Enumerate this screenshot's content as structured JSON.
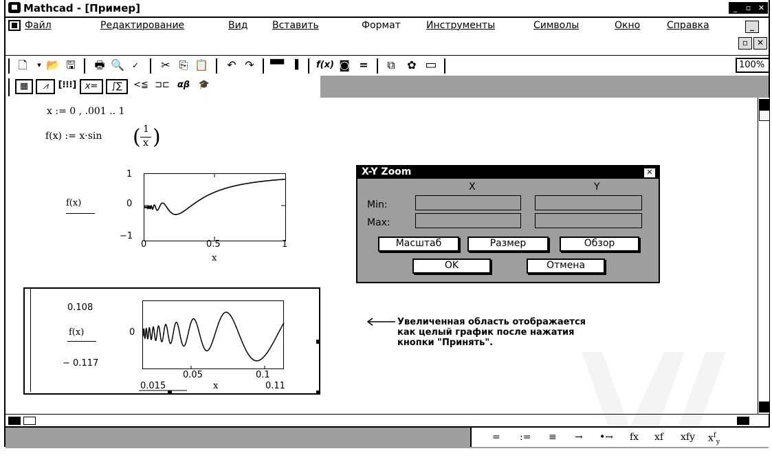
{
  "window": {
    "title": "Mathcad - [Пример]"
  },
  "menu": {
    "items": [
      "Файл",
      "Редактирование",
      "Вид",
      "Вставить",
      "Формат",
      "Инструменты",
      "Символы",
      "Окно",
      "Справка"
    ]
  },
  "toolbar": {
    "zoom": "100%"
  },
  "math_toolbar": {
    "eq_label": "x=",
    "compare_label": "<≦",
    "greek_label": "αβ"
  },
  "worksheet": {
    "range_def": "x := 0 , .001 .. 1",
    "func_def_prefix": "f(x) := x·sin",
    "func_def_num": "1",
    "func_def_den": "x",
    "plot1": {
      "ylabel": "f(x)",
      "xlabel": "x",
      "y_ticks": [
        "1",
        "0",
        "−1"
      ],
      "x_ticks": [
        "0",
        "0.5",
        "1"
      ]
    },
    "plot2": {
      "ylabel": "f(x)",
      "xlabel": "x",
      "y_top": "0.108",
      "y_mid": "0",
      "y_bottom": "− 0.117",
      "x_ticks": [
        "0.05",
        "0.1"
      ],
      "x_min": "0.015",
      "x_max": "0.11"
    },
    "annotation": [
      "Увеличенная область отображается",
      "как целый график после нажатия",
      "кнопки \"Принять\"."
    ]
  },
  "dialog": {
    "title": "X-Y Zoom",
    "col_x": "X",
    "col_y": "Y",
    "min_label": "Min:",
    "max_label": "Max:",
    "buttons": {
      "zoom": "Масштаб",
      "resize": "Размер",
      "browse": "Обзор",
      "ok": "OK",
      "cancel": "Отмена"
    }
  },
  "status": {
    "symbols": [
      "=",
      ":=",
      "≡",
      "→",
      "•→",
      "fx",
      "xf",
      "xfy"
    ]
  },
  "watermark": "УИР",
  "chart_data": [
    {
      "type": "line",
      "ylabel": "f(x)",
      "xlabel": "x",
      "xlim": [
        0,
        1
      ],
      "ylim": [
        -1,
        1
      ],
      "x": [
        0.2,
        0.25,
        0.3,
        0.4,
        0.5,
        0.6,
        0.7,
        0.8,
        0.9,
        1.0
      ],
      "y": [
        -0.19,
        -0.19,
        -0.06,
        0.24,
        0.45,
        0.6,
        0.69,
        0.76,
        0.8,
        0.84
      ]
    },
    {
      "type": "line",
      "ylabel": "f(x)",
      "xlabel": "x",
      "xlim": [
        0.015,
        0.11
      ],
      "ylim": [
        -0.117,
        0.108
      ]
    }
  ]
}
